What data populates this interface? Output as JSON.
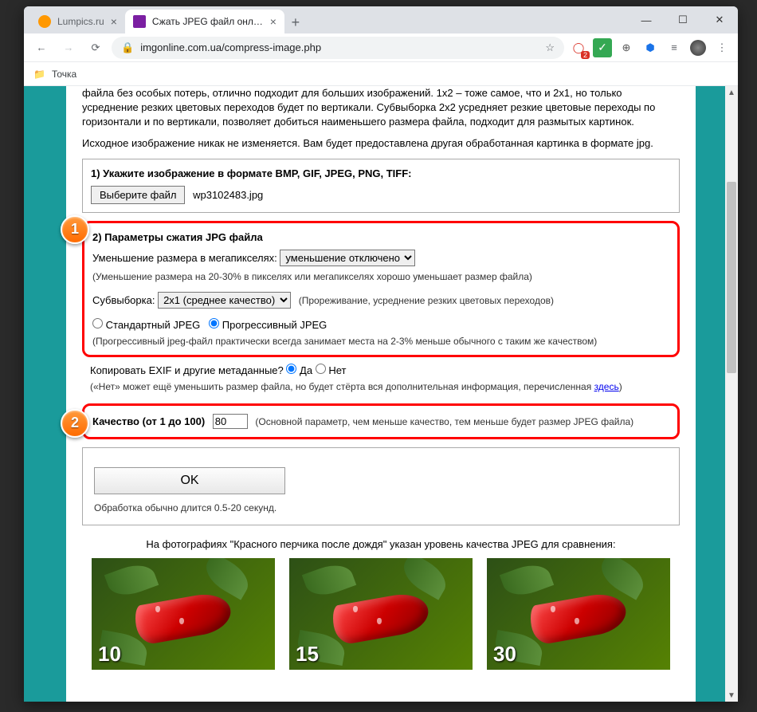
{
  "tabs": [
    {
      "title": "Lumpics.ru",
      "favicon_color": "#ff9800"
    },
    {
      "title": "Сжать JPEG файл онлайн - IMG",
      "favicon_color": "#7b1fa2"
    }
  ],
  "address": {
    "url": "imgonline.com.ua/compress-image.php"
  },
  "ext_badge": "2",
  "bookmarks": {
    "folder": "Точка"
  },
  "page": {
    "intro1": "файла без особых потерь, отлично подходит для больших изображений. 1x2 – тоже самое, что и 2x1, но только усреднение резких цветовых переходов будет по вертикали. Субвыборка 2x2 усредняет резкие цветовые переходы по горизонтали и по вертикали, позволяет добиться наименьшего размера файла, подходит для размытых картинок.",
    "intro2": "Исходное изображение никак не изменяется. Вам будет предоставлена другая обработанная картинка в формате jpg.",
    "step1": {
      "title": "1) Укажите изображение в формате BMP, GIF, JPEG, PNG, TIFF:",
      "button": "Выберите файл",
      "filename": "wp3102483.jpg"
    },
    "step2": {
      "title": "2) Параметры сжатия JPG файла",
      "mp_label": "Уменьшение размера в мегапикселях:",
      "mp_value": "уменьшение отключено",
      "mp_hint": "(Уменьшение размера на 20-30% в пикселях или мегапикселях хорошо уменьшает размер файла)",
      "sub_label": "Субвыборка:",
      "sub_value": "2x1 (среднее качество)",
      "sub_hint": "(Прореживание, усреднение резких цветовых переходов)",
      "std_label": "Стандартный JPEG",
      "prog_label": "Прогрессивный JPEG",
      "prog_hint": "(Прогрессивный jpeg-файл практически всегда занимает места на 2-3% меньше обычного с таким же качеством)"
    },
    "exif": {
      "label": "Копировать EXIF и другие метаданные?",
      "yes": "Да",
      "no": "Нет",
      "hint_prefix": "(«Нет» может ещё уменьшить размер файла, но будет стёрта вся дополнительная информация, перечисленная ",
      "hint_link": "здесь",
      "hint_suffix": ")"
    },
    "quality": {
      "label": "Качество (от 1 до 100)",
      "value": "80",
      "hint": "(Основной параметр, чем меньше качество, тем меньше будет размер JPEG файла)"
    },
    "ok": "OK",
    "processing": "Обработка обычно длится 0.5-20 секунд.",
    "samples_title": "На фотографиях \"Красного перчика после дождя\" указан уровень качества JPEG для сравнения:",
    "samples": [
      "10",
      "15",
      "30"
    ]
  }
}
